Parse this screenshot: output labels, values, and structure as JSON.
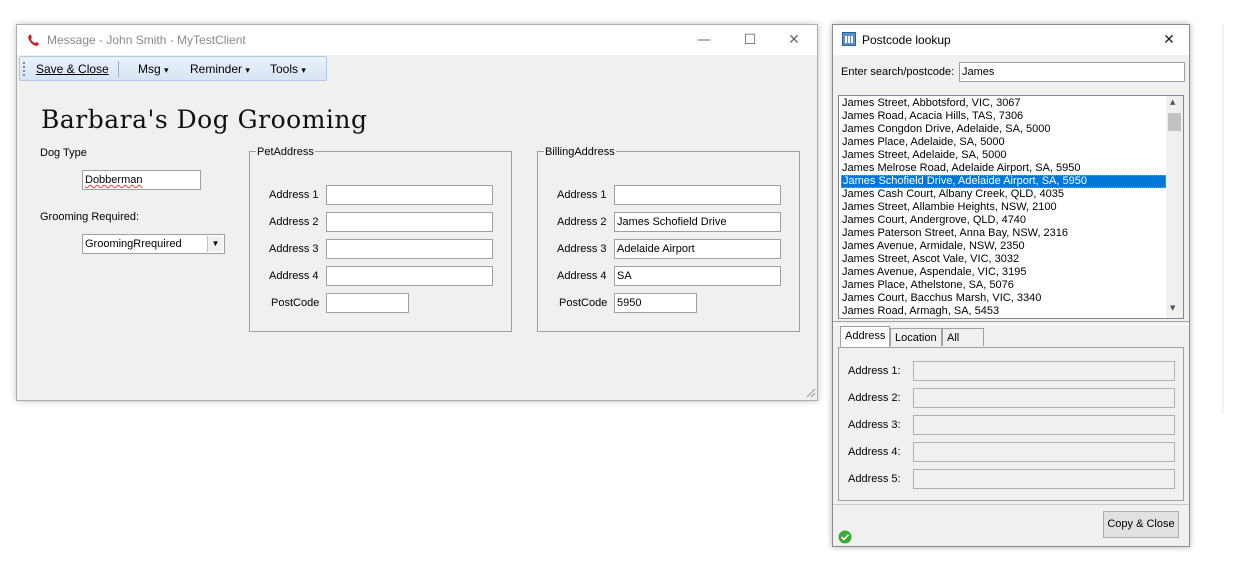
{
  "main_window": {
    "title": "Message - John Smith  -  MyTestClient",
    "controls": {
      "minimize": "—",
      "maximize": "☐",
      "close": "✕"
    },
    "toolbar": {
      "save_close": "Save & Close",
      "msg": "Msg",
      "reminder": "Reminder",
      "tools": "Tools",
      "dropdown_glyph": "▾"
    },
    "business_title": "Barbara's Dog Grooming",
    "dog_type": {
      "label": "Dog Type",
      "value": "Dobberman"
    },
    "grooming": {
      "label": "Grooming Required:",
      "value": "GroomingRrequired",
      "arrow": "▼"
    },
    "pet_address": {
      "title": "PetAddress",
      "address1_label": "Address 1",
      "address1": "",
      "address2_label": "Address 2",
      "address2": "",
      "address3_label": "Address 3",
      "address3": "",
      "address4_label": "Address 4",
      "address4": "",
      "postcode_label": "PostCode",
      "postcode": ""
    },
    "billing_address": {
      "title": "BillingAddress",
      "address1_label": "Address 1",
      "address1": "",
      "address2_label": "Address 2",
      "address2": "James Schofield Drive",
      "address3_label": "Address 3",
      "address3": "Adelaide Airport",
      "address4_label": "Address 4",
      "address4": "SA",
      "postcode_label": "PostCode",
      "postcode": "5950"
    }
  },
  "lookup_window": {
    "title": "Postcode lookup",
    "close": "✕",
    "search_label": "Enter search/postcode:",
    "search_value": "James",
    "results": [
      "James Street, Abbotsford, VIC, 3067",
      "James Road, Acacia Hills, TAS, 7306",
      "James Congdon Drive, Adelaide, SA, 5000",
      "James Place, Adelaide, SA, 5000",
      "James Street, Adelaide, SA, 5000",
      "James Melrose Road, Adelaide Airport, SA, 5950",
      "James Schofield Drive, Adelaide Airport, SA, 5950",
      "James Cash Court, Albany Creek, QLD, 4035",
      "James Street, Allambie Heights, NSW, 2100",
      "James Court, Andergrove, QLD, 4740",
      "James Paterson Street, Anna Bay, NSW, 2316",
      "James Avenue, Armidale, NSW, 2350",
      "James Street, Ascot Vale, VIC, 3032",
      "James Avenue, Aspendale, VIC, 3195",
      "James Place, Athelstone, SA, 5076",
      "James Court, Bacchus Marsh, VIC, 3340",
      "James Road, Armagh, SA, 5453"
    ],
    "selected_index": 6,
    "scroll_up": "▲",
    "scroll_down": "▼",
    "tabs": [
      "Address",
      "Location",
      "All"
    ],
    "active_tab": "Address",
    "fields": {
      "address1_label": "Address 1:",
      "address2_label": "Address 2:",
      "address3_label": "Address 3:",
      "address4_label": "Address 4:",
      "address5_label": "Address 5:"
    },
    "copy_close": "Copy & Close",
    "status_icon": "ok-icon"
  },
  "colors": {
    "selection": "#0078d7",
    "toolbar": "#d7e4f5",
    "window_bg": "#f0f0f0"
  }
}
